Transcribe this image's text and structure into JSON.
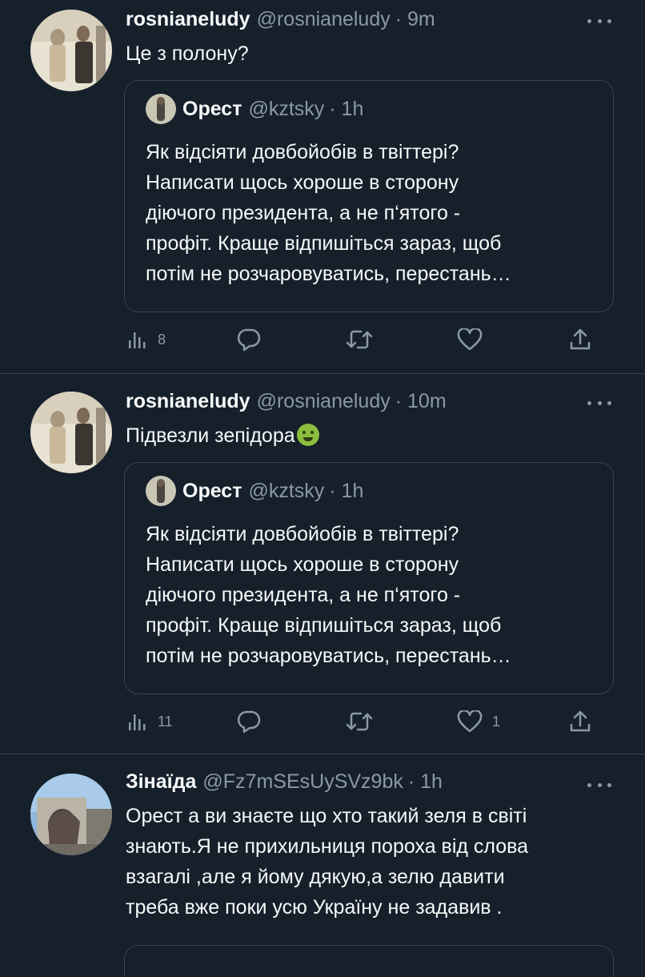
{
  "tweets": [
    {
      "name": "rosnianeludy",
      "handle": "@rosnianeludy",
      "time": "· 9m",
      "text": "Це з полону?",
      "quote": {
        "name": "Орест",
        "handle": "@kztsky",
        "time": "· 1h",
        "lines": [
          "Як відсіяти довбойобів в твіттері?",
          "Написати щось хороше в сторону",
          "діючого президента, а не п‘ятого -",
          "профіт. Краще відпишіться зараз, щоб",
          "потім не розчаровуватись, перестань…"
        ]
      },
      "views": "8",
      "likes": ""
    },
    {
      "name": "rosnianeludy",
      "handle": "@rosnianeludy",
      "time": "· 10m",
      "text": "Підвезли зепідора",
      "quote": {
        "name": "Орест",
        "handle": "@kztsky",
        "time": "· 1h",
        "lines": [
          "Як відсіяти довбойобів в твіттері?",
          "Написати щось хороше в сторону",
          "діючого президента, а не п‘ятого -",
          "профіт. Краще відпишіться зараз, щоб",
          "потім не розчаровуватись, перестань…"
        ]
      },
      "views": "11",
      "likes": "1"
    },
    {
      "name": "Зінаїда",
      "handle": "@Fz7mSEsUySVz9bk",
      "time": "· 1h",
      "lines": [
        "Орест а ви знаєте що хто такий зеля в світі",
        "знають.Я не прихильниця пороха від слова",
        "взагалі ,але я йому дякую,а зелю давити",
        "треба вже поки усю Україну не задавив ."
      ]
    }
  ],
  "icons": {
    "views": "bar-chart-icon",
    "reply": "speech-bubble-icon",
    "retweet": "retweet-arrows-icon",
    "like": "heart-icon",
    "share": "share-upload-icon",
    "more": "more-dots-icon",
    "emoji": "nauseated-face-emoji"
  },
  "colors": {
    "background": "#15202b",
    "text": "#f7f9f9",
    "secondary": "#8b98a5",
    "border": "#38444d"
  }
}
